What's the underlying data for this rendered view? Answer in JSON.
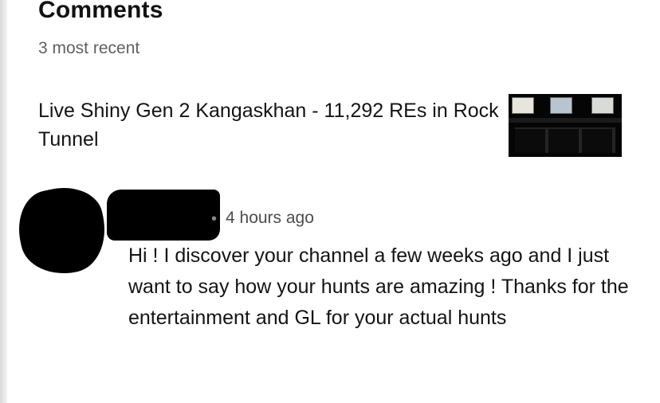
{
  "section": {
    "title": "Comments",
    "subtitle": "3 most recent"
  },
  "video": {
    "title": "Live Shiny Gen 2 Kangaskhan - 11,292 REs in Rock Tunnel",
    "thumbnail": "video-thumbnail"
  },
  "comment": {
    "author_avatar": "redacted",
    "author_name": "redacted",
    "separator": "•",
    "time": "4 hours ago",
    "text": "Hi ! I discover your channel a few weeks ago and I just want to say how your hunts are amazing ! Thanks for the entertainment and GL for your actual hunts"
  }
}
